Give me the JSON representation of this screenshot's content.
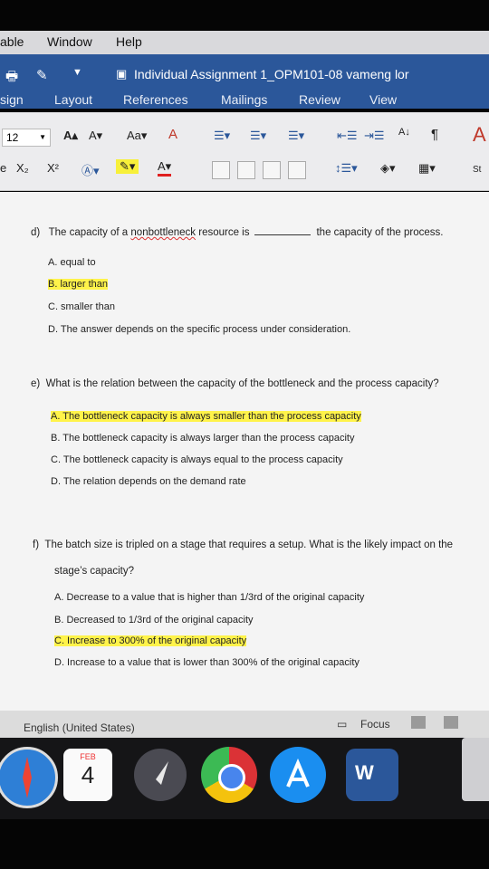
{
  "menubar": {
    "items": [
      "able",
      "Window",
      "Help"
    ]
  },
  "titlebar": {
    "doc_title": "Individual Assignment 1_OPM101-08 vameng lor",
    "tabs": [
      "sign",
      "Layout",
      "References",
      "Mailings",
      "Review",
      "View"
    ]
  },
  "ribbon": {
    "font_size": "12",
    "subscript": "X₂",
    "superscript": "X²",
    "styles_label": "St"
  },
  "questions": [
    {
      "label": "d)",
      "text_before": "The capacity of a",
      "underlined": "nonbottleneck",
      "text_mid": "resource is",
      "text_after": "the capacity of the process.",
      "options": [
        "A.  equal to",
        "B.  larger than",
        "C.  smaller than",
        "D.  The answer depends on the specific process under consideration."
      ],
      "highlighted": 1
    },
    {
      "label": "e)",
      "text": "What is the relation between the capacity of the bottleneck and the process capacity?",
      "options": [
        "A.  The bottleneck capacity is always smaller than the process capacity",
        "B.  The bottleneck capacity is always larger than the process capacity",
        "C.  The bottleneck capacity is always equal to the process capacity",
        "D.  The relation depends on the demand rate"
      ],
      "highlighted": 0
    },
    {
      "label": "f)",
      "text_line1": "The batch size is tripled on a stage that requires a setup. What is the likely impact on the",
      "text_line2": "stage’s capacity?",
      "options": [
        "A.  Decrease to a value that is higher than 1/3rd of the original capacity",
        "B.  Decreased to 1/3rd of the original capacity",
        "C.  Increase to 300% of the original capacity",
        "D.  Increase to a value that is lower than 300% of the original capacity"
      ],
      "highlighted": 2
    }
  ],
  "status": {
    "language": "English (United States)",
    "focus": "Focus"
  },
  "dock": {
    "calendar_month": "FEB",
    "calendar_day": "4",
    "word_letter": "W"
  },
  "colors": {
    "word_blue": "#2b579a",
    "highlight": "#fff34a"
  }
}
